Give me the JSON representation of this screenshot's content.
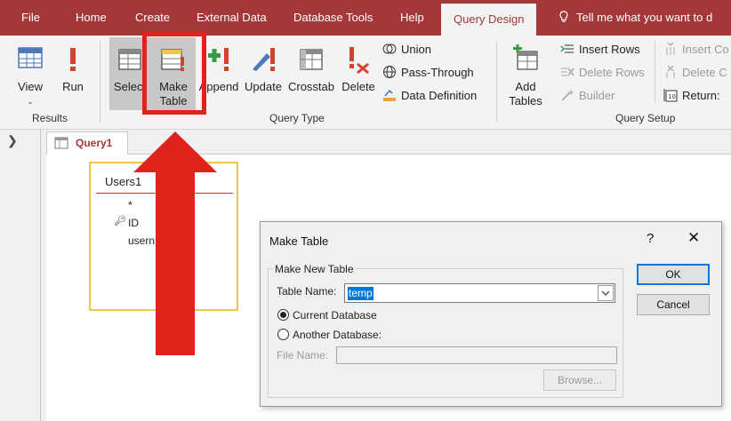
{
  "menubar": {
    "tabs": [
      {
        "label": "File"
      },
      {
        "label": "Home"
      },
      {
        "label": "Create"
      },
      {
        "label": "External Data"
      },
      {
        "label": "Database Tools"
      },
      {
        "label": "Help"
      },
      {
        "label": "Query Design"
      }
    ],
    "active_tab": "Query Design",
    "tell_me": "Tell me what you want to d"
  },
  "ribbon": {
    "results": {
      "label": "Results",
      "view": "View",
      "run": "Run"
    },
    "query_type": {
      "label": "Query Type",
      "select": "Select",
      "make_table": "Make Table",
      "append": "Append",
      "update": "Update",
      "crosstab": "Crosstab",
      "delete": "Delete",
      "union": "Union",
      "pass_through": "Pass-Through",
      "data_definition": "Data Definition"
    },
    "query_setup": {
      "label": "Query Setup",
      "add_tables": "Add Tables",
      "insert_rows": "Insert Rows",
      "delete_rows": "Delete Rows",
      "builder": "Builder",
      "insert_columns": "Insert Co",
      "delete_columns": "Delete C",
      "return": "Return:"
    }
  },
  "document": {
    "tab_label": "Query1",
    "table": {
      "name": "Users1",
      "fields": [
        "*",
        "ID",
        "usern"
      ]
    }
  },
  "dialog": {
    "title": "Make Table",
    "help": "?",
    "close": "✕",
    "group_label": "Make New Table",
    "table_name_label": "Table Name:",
    "table_name_value": "temp",
    "current_db": "Current Database",
    "another_db": "Another Database:",
    "file_name_label": "File Name:",
    "browse": "Browse...",
    "ok": "OK",
    "cancel": "Cancel"
  },
  "colors": {
    "access_red": "#a4373a",
    "highlight_red": "#e0221c",
    "select_blue": "#0078d7"
  }
}
